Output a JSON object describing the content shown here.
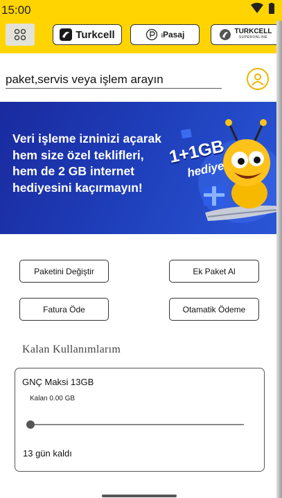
{
  "status_bar": {
    "time": "15:00"
  },
  "brands": {
    "turkcell": "Turkcell",
    "pasaj_prefix": "i",
    "pasaj": "Pasaj",
    "superonline_top": "TURKCELL",
    "superonline_bottom": "SUPERONLINE"
  },
  "search": {
    "placeholder": "paket,servis veya işlem arayın"
  },
  "banner": {
    "lines": [
      "Veri işleme izninizi açarak",
      "hem size özel teklifleri,",
      "hem de 2 GB internet",
      "hediyesini kaçırmayın!"
    ],
    "gb_label": "1+1GB",
    "gift_label": "hediye"
  },
  "actions": {
    "change_package": "Paketini Değiştir",
    "extra_package": "Ek Paket Al",
    "pay_bill": "Fatura Öde",
    "auto_payment": "Otamatik Ödeme"
  },
  "usage": {
    "title": "Kalan Kullanımlarım",
    "package_name": "GNÇ Maksi 13GB",
    "remaining": "Kalan 0.00 GB",
    "remaining_fraction": 0,
    "days_left": "13 gün kaldı"
  },
  "colors": {
    "brand_yellow": "#ffd400",
    "banner_blue": "#1e3db8",
    "accent_orange": "#f0b400"
  }
}
